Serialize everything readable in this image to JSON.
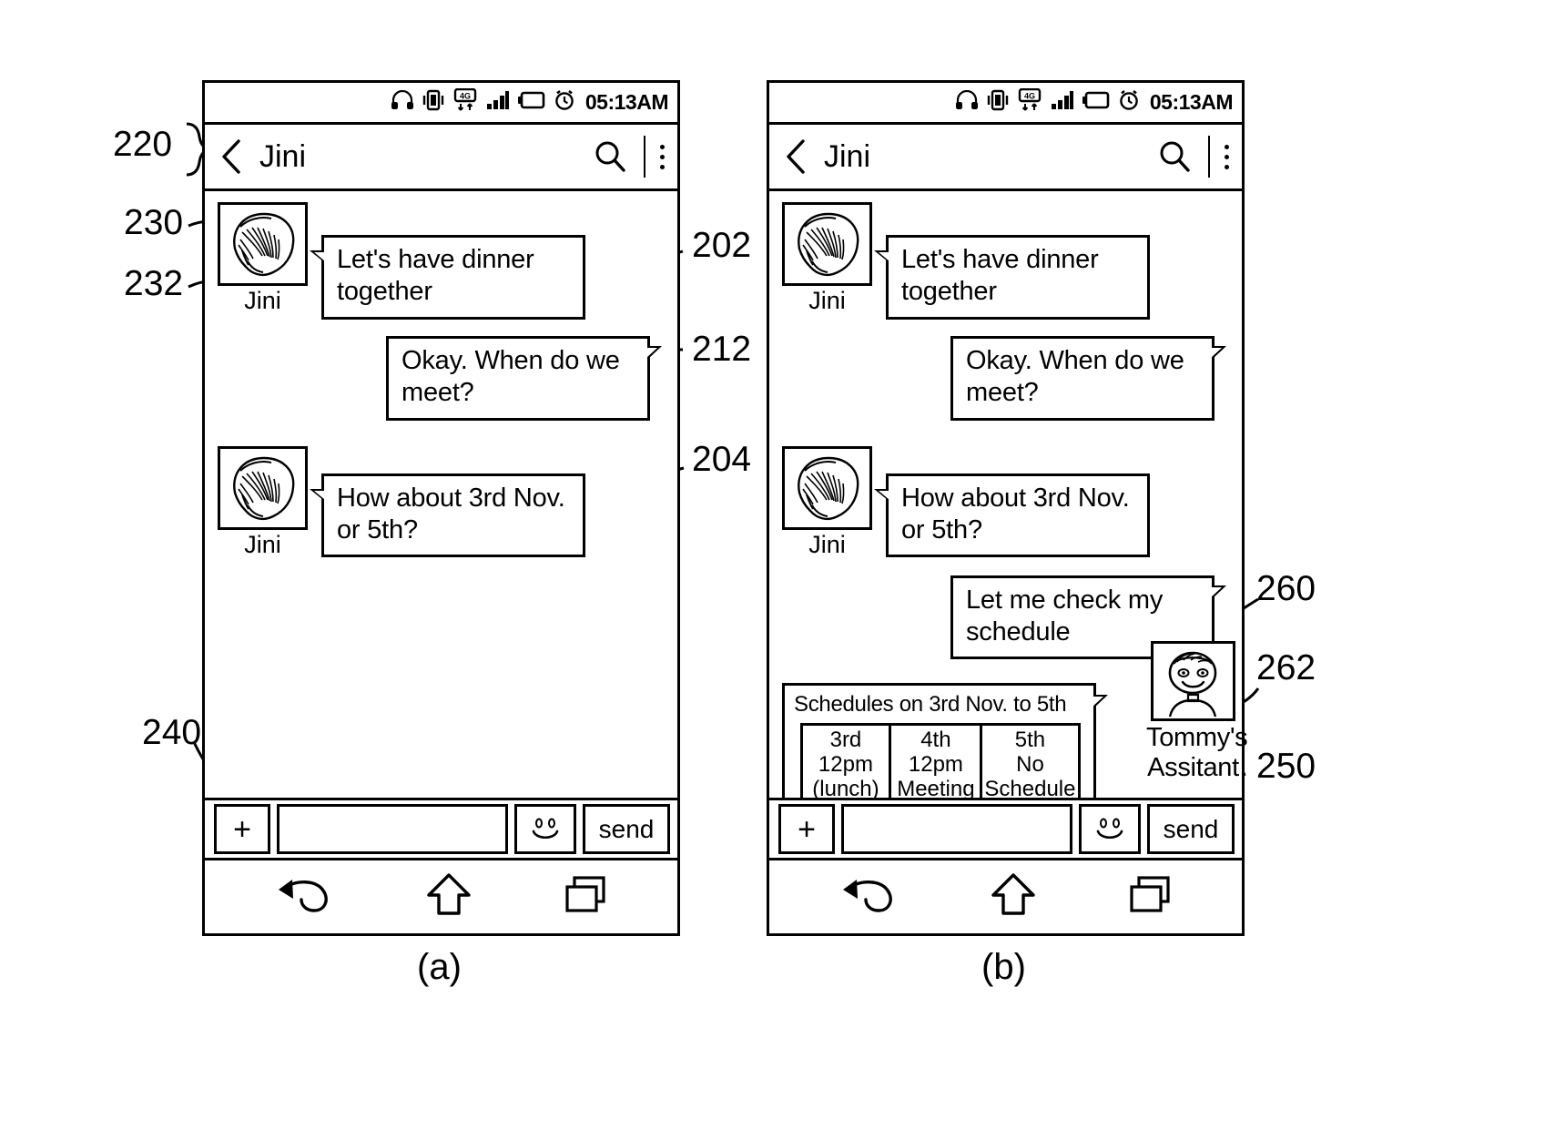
{
  "figure": {
    "panel_a_label": "(a)",
    "panel_b_label": "(b)",
    "reference_numerals": {
      "n220": "220",
      "n230": "230",
      "n232": "232",
      "n240": "240",
      "n202": "202",
      "n212": "212",
      "n204": "204",
      "n250": "250",
      "n260": "260",
      "n262": "262"
    }
  },
  "statusbar": {
    "time": "05:13AM",
    "icons": [
      "headphones-icon",
      "vibrate-icon",
      "4g-data-icon",
      "signal-bars-icon",
      "battery-icon",
      "alarm-clock-icon"
    ],
    "network_label": "4G"
  },
  "titlebar": {
    "back_label": "back-chevron",
    "contact_name": "Jini",
    "search_label": "search-icon",
    "overflow_label": "more-options-icon"
  },
  "panel_a": {
    "messages": [
      {
        "side": "in",
        "sender": "Jini",
        "text": "Let's have dinner together",
        "ref": "202"
      },
      {
        "side": "out",
        "text": "Okay. When do we meet?",
        "ref": "212"
      },
      {
        "side": "in",
        "sender": "Jini",
        "text": "How about 3rd Nov. or 5th?",
        "ref": "204"
      }
    ]
  },
  "panel_b": {
    "messages": [
      {
        "side": "in",
        "sender": "Jini",
        "text": "Let's have dinner together"
      },
      {
        "side": "out",
        "text": "Okay. When do we meet?"
      },
      {
        "side": "in",
        "sender": "Jini",
        "text": "How about 3rd Nov. or 5th?"
      },
      {
        "side": "out",
        "text": "Let me check my schedule"
      }
    ],
    "schedule_card": {
      "title": "Schedules on 3rd Nov. to 5th",
      "columns": [
        "3rd",
        "4th",
        "5th"
      ],
      "rows": [
        [
          "12pm",
          "12pm",
          "No"
        ],
        [
          "(lunch)",
          "Meeting",
          "Schedule"
        ]
      ],
      "cells": [
        {
          "day": "3rd",
          "line1": "12pm",
          "line2": "(lunch)"
        },
        {
          "day": "4th",
          "line1": "12pm",
          "line2": "Meeting"
        },
        {
          "day": "5th",
          "line1": "No",
          "line2": "Schedule"
        }
      ]
    },
    "assistant": {
      "name_line1": "Tommy's",
      "name_line2": "Assitant",
      "avatar_label": "assistant-avatar"
    }
  },
  "inputbar": {
    "plus_label": "+",
    "text_value": "",
    "text_placeholder": "",
    "emoji_label": "emoji-icon",
    "send_label": "send"
  },
  "navbar": {
    "back_label": "nav-back-icon",
    "home_label": "nav-home-icon",
    "recents_label": "nav-recents-icon"
  }
}
